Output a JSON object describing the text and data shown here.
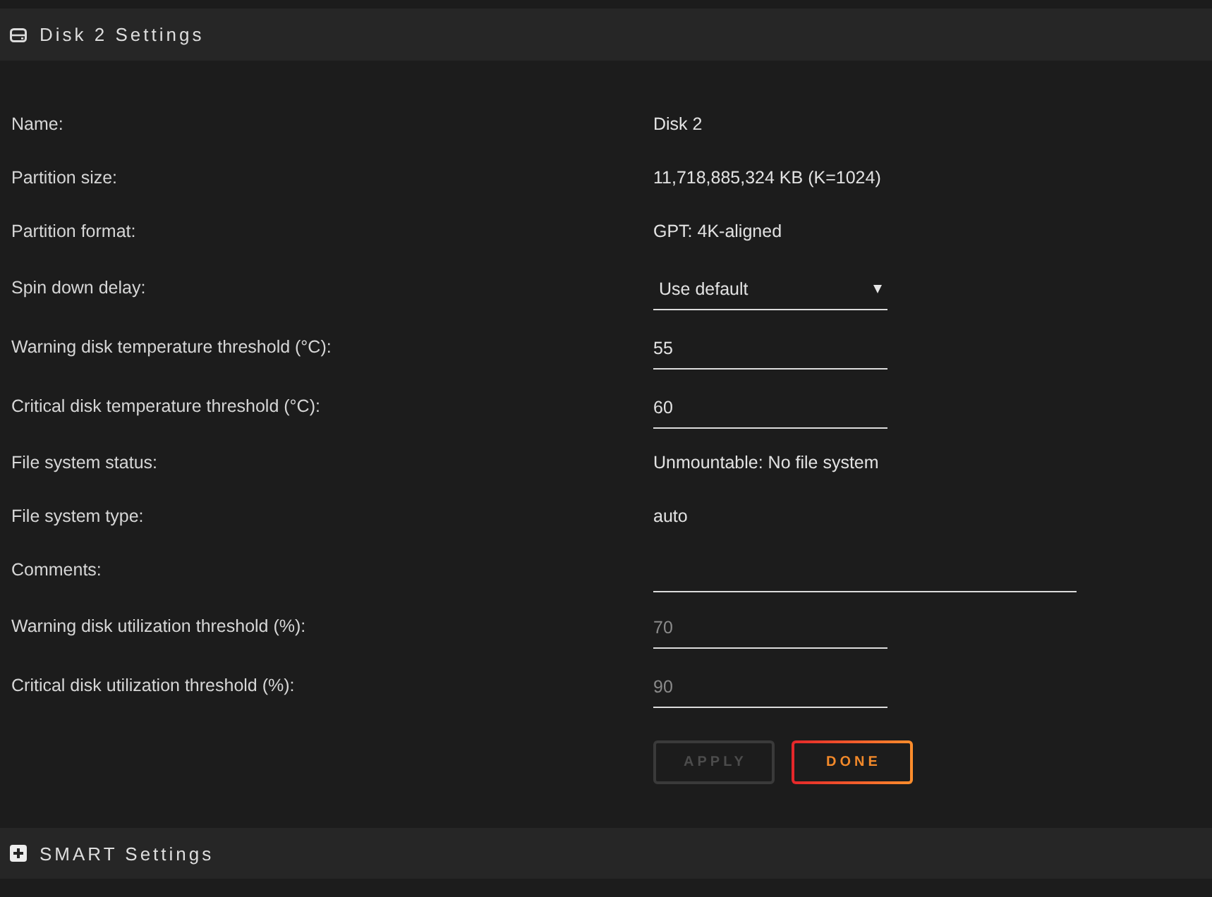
{
  "settings_panel": {
    "title": "Disk 2 Settings",
    "fields": [
      {
        "kind": "text",
        "label": "Name:",
        "value": "Disk 2"
      },
      {
        "kind": "text",
        "label": "Partition size:",
        "value": "11,718,885,324 KB (K=1024)"
      },
      {
        "kind": "text",
        "label": "Partition format:",
        "value": "GPT: 4K-aligned"
      },
      {
        "kind": "select",
        "label": "Spin down delay:",
        "value": "Use default"
      },
      {
        "kind": "number",
        "label": "Warning disk temperature threshold (°C):",
        "value": "55"
      },
      {
        "kind": "number",
        "label": "Critical disk temperature threshold (°C):",
        "value": "60"
      },
      {
        "kind": "text",
        "label": "File system status:",
        "value": "Unmountable: No file system"
      },
      {
        "kind": "text",
        "label": "File system type:",
        "value": "auto"
      },
      {
        "kind": "text_input",
        "label": "Comments:"
      },
      {
        "kind": "number",
        "label": "Warning disk utilization threshold (%):",
        "placeholder": "70"
      },
      {
        "kind": "number",
        "label": "Critical disk utilization threshold (%):",
        "placeholder": "90"
      }
    ],
    "buttons": [
      {
        "label": "APPLY",
        "disabled": true
      },
      {
        "label": "DONE",
        "disabled": false
      }
    ]
  },
  "smart_panel": {
    "title": "SMART Settings",
    "expanded": false
  }
}
